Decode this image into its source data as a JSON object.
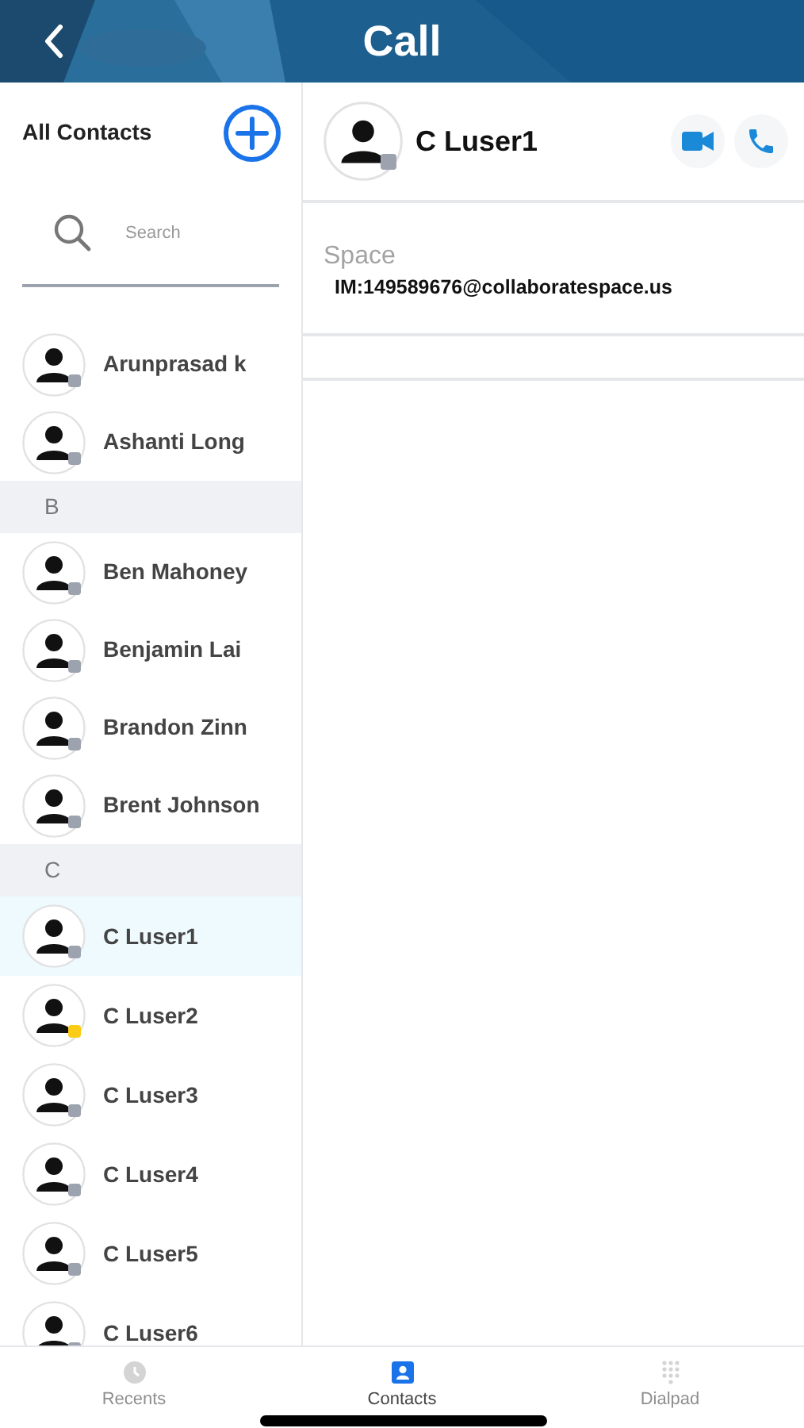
{
  "header": {
    "title": "Call"
  },
  "sidebar": {
    "title": "All Contacts",
    "search": {
      "placeholder": "Search"
    },
    "items": [
      {
        "kind": "contact",
        "name": "Arunprasad k",
        "color": "#9ca3af",
        "selected": false
      },
      {
        "kind": "contact",
        "name": "Ashanti Long",
        "color": "#9ca3af",
        "selected": false
      },
      {
        "kind": "section",
        "name": "B"
      },
      {
        "kind": "contact",
        "name": "Ben Mahoney",
        "color": "#9ca3af",
        "selected": false
      },
      {
        "kind": "contact",
        "name": "Benjamin Lai",
        "color": "#9ca3af",
        "selected": false
      },
      {
        "kind": "contact",
        "name": "Brandon Zinn",
        "color": "#9ca3af",
        "selected": false
      },
      {
        "kind": "contact",
        "name": "Brent Johnson",
        "color": "#9ca3af",
        "selected": false
      },
      {
        "kind": "section",
        "name": "C"
      },
      {
        "kind": "contact",
        "name": "C Luser1",
        "color": "#9ca3af",
        "selected": true
      },
      {
        "kind": "contact",
        "name": "C Luser2",
        "color": "#facc15",
        "selected": false
      },
      {
        "kind": "contact",
        "name": "C Luser3",
        "color": "#9ca3af",
        "selected": false
      },
      {
        "kind": "contact",
        "name": "C Luser4",
        "color": "#9ca3af",
        "selected": false
      },
      {
        "kind": "contact",
        "name": "C Luser5",
        "color": "#9ca3af",
        "selected": false
      },
      {
        "kind": "contact",
        "name": "C Luser6",
        "color": "#9ca3af",
        "selected": false
      }
    ]
  },
  "detail": {
    "name": "C Luser1",
    "color": "#9ca3af",
    "fields": [
      {
        "label": "Space",
        "value": "IM:149589676@collaboratespace.us"
      }
    ]
  },
  "tabs": [
    {
      "label": "Recents",
      "selected": false
    },
    {
      "label": "Contacts",
      "selected": true
    },
    {
      "label": "Dialpad",
      "selected": false
    }
  ]
}
